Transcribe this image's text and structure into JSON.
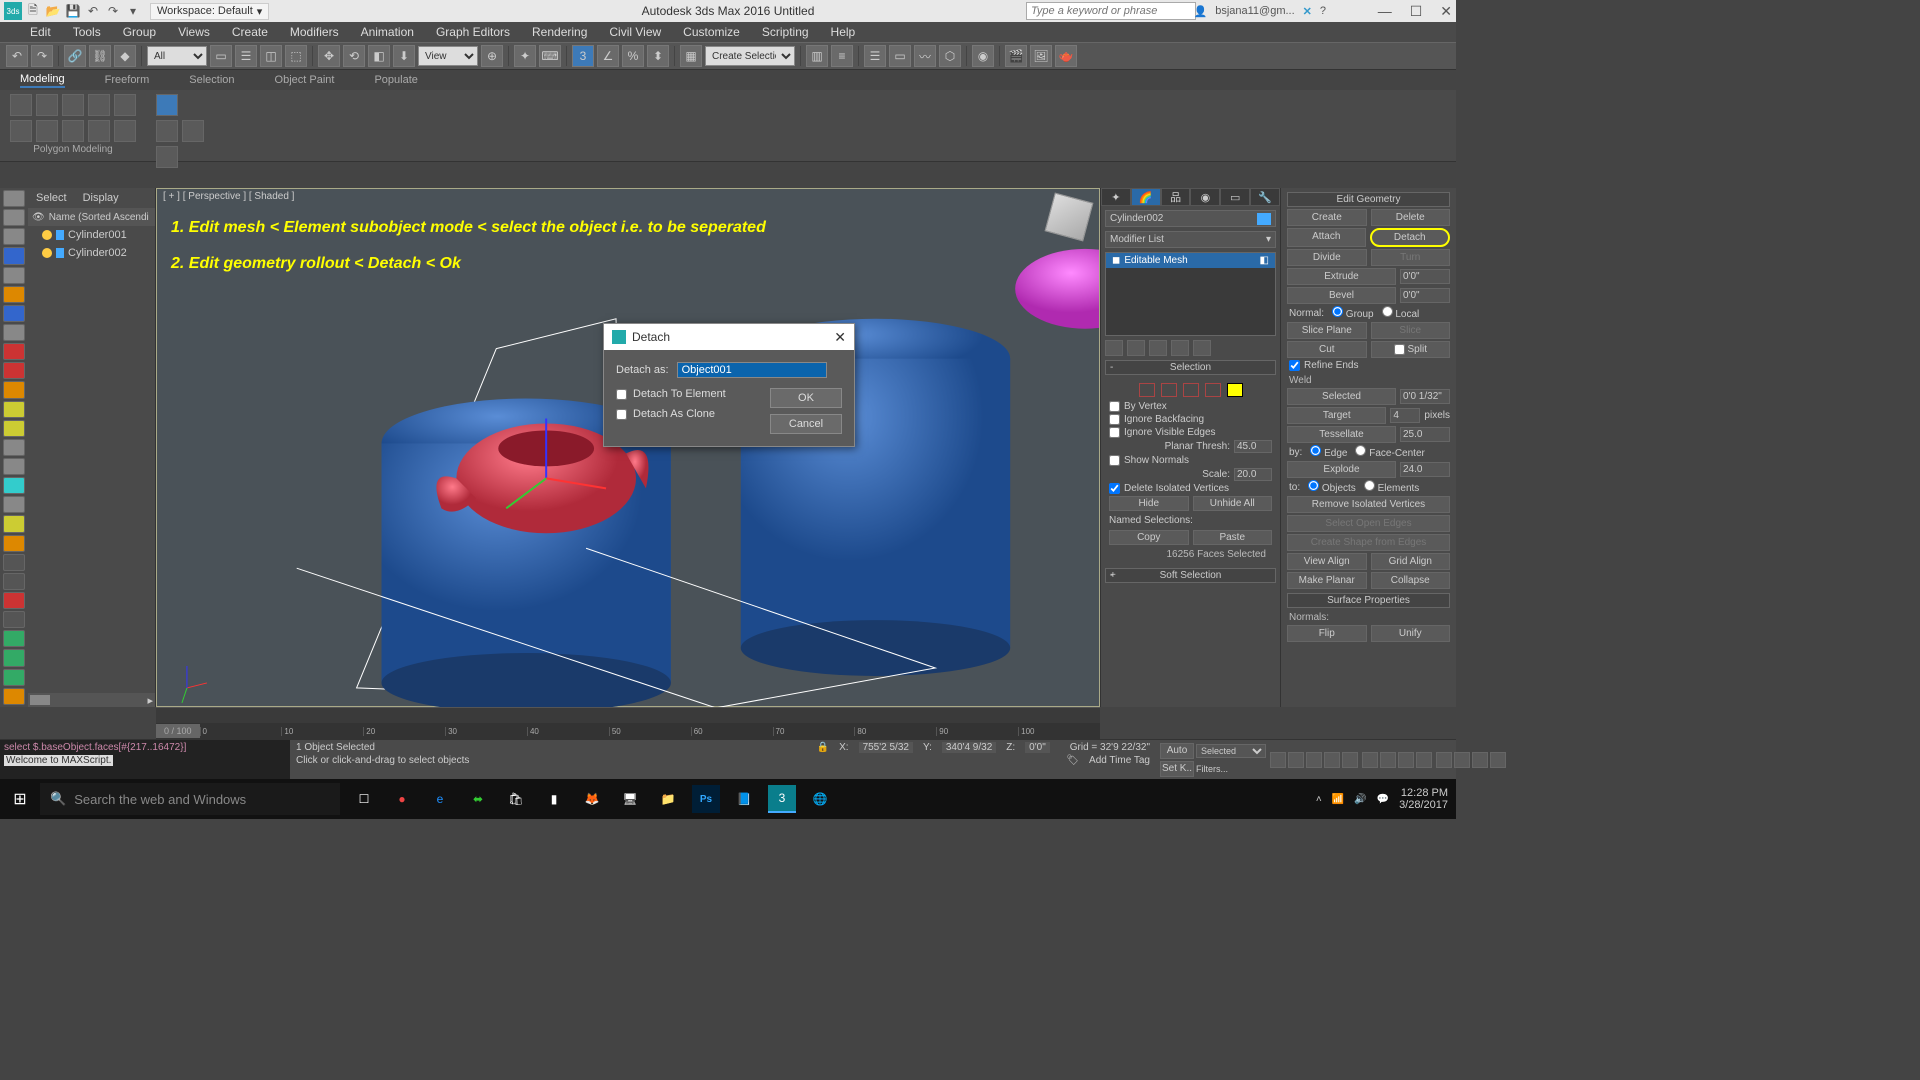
{
  "app": {
    "title": "Autodesk 3ds Max 2016   Untitled",
    "workspace_label": "Workspace: Default",
    "search_placeholder": "Type a keyword or phrase",
    "user": "bsjana11@gm..."
  },
  "menu": [
    "Edit",
    "Tools",
    "Group",
    "Views",
    "Create",
    "Modifiers",
    "Animation",
    "Graph Editors",
    "Rendering",
    "Civil View",
    "Customize",
    "Scripting",
    "Help"
  ],
  "toolbar": {
    "combo_all": "All",
    "combo_view": "View",
    "combo_create_sel": "Create Selection S"
  },
  "ribbon": {
    "tabs": [
      "Modeling",
      "Freeform",
      "Selection",
      "Object Paint",
      "Populate"
    ],
    "group_caption": "Polygon Modeling"
  },
  "scene_explorer": {
    "menu": [
      "Select",
      "Display"
    ],
    "header": "Name (Sorted Ascendi",
    "rows": [
      "Cylinder001",
      "Cylinder002"
    ]
  },
  "viewport": {
    "label": "[ + ] [ Perspective ] [ Shaded ]",
    "annot1": "1.  Edit mesh  <   Element subobject mode  < select the object i.e. to be seperated",
    "annot2": "2.  Edit geometry rollout < Detach < Ok"
  },
  "dialog": {
    "title": "Detach",
    "label_as": "Detach as:",
    "value": "Object001",
    "chk_element": "Detach To Element",
    "chk_clone": "Detach As Clone",
    "ok": "OK",
    "cancel": "Cancel"
  },
  "cmd": {
    "objname": "Cylinder002",
    "modlist": "Modifier List",
    "stack_item": "Editable Mesh",
    "rollout_selection": "Selection",
    "by_vertex": "By Vertex",
    "ignore_backfacing": "Ignore Backfacing",
    "ignore_visible": "Ignore Visible Edges",
    "planar_label": "Planar Thresh:",
    "planar_val": "45.0",
    "show_normals": "Show Normals",
    "scale_label": "Scale:",
    "scale_val": "20.0",
    "delete_iso": "Delete Isolated Vertices",
    "hide": "Hide",
    "unhide": "Unhide All",
    "named_sel": "Named Selections:",
    "copy": "Copy",
    "paste": "Paste",
    "faces_sel": "16256 Faces Selected",
    "rollout_soft": "Soft Selection"
  },
  "editgeo": {
    "header": "Edit Geometry",
    "create": "Create",
    "delete": "Delete",
    "attach": "Attach",
    "detach": "Detach",
    "divide": "Divide",
    "turn": "Turn",
    "extrude": "Extrude",
    "extrude_val": "0'0\"",
    "bevel": "Bevel",
    "bevel_val": "0'0\"",
    "normal": "Normal:",
    "group": "Group",
    "local": "Local",
    "slice_plane": "Slice Plane",
    "slice": "Slice",
    "cut": "Cut",
    "split": "Split",
    "refine_ends": "Refine Ends",
    "weld": "Weld",
    "selected": "Selected",
    "selected_val": "0'0 1/32\"",
    "target": "Target",
    "target_val": "4",
    "pixels": "pixels",
    "tessellate": "Tessellate",
    "tess_val": "25.0",
    "by": "by:",
    "edge": "Edge",
    "face_center": "Face-Center",
    "explode": "Explode",
    "explode_val": "24.0",
    "to": "to:",
    "objects": "Objects",
    "elements": "Elements",
    "remove_iso": "Remove Isolated Vertices",
    "select_open": "Select Open Edges",
    "create_shape": "Create Shape from Edges",
    "view_align": "View Align",
    "grid_align": "Grid Align",
    "make_planar": "Make Planar",
    "collapse": "Collapse",
    "surf_props": "Surface Properties",
    "normals": "Normals:",
    "flip": "Flip",
    "unify": "Unify"
  },
  "status": {
    "script1": "select $.baseObject.faces[#{217..16472}]",
    "script2": "Welcome to MAXScript.",
    "obj_sel": "1 Object Selected",
    "prompt": "Click or click-and-drag to select objects",
    "x": "755'2 5/32",
    "y": "340'4 9/32",
    "z": "0'0\"",
    "grid": "Grid = 32'9 22/32\"",
    "auto": "Auto",
    "setk": "Set K..",
    "sel_combo": "Selected",
    "filters": "Filters...",
    "addtag": "Add Time Tag",
    "slider": "0 / 100",
    "ticks": [
      "0",
      "10",
      "20",
      "30",
      "40",
      "50",
      "60",
      "70",
      "80",
      "90",
      "100"
    ]
  },
  "taskbar": {
    "search_placeholder": "Search the web and Windows",
    "time": "12:28 PM",
    "date": "3/28/2017"
  }
}
